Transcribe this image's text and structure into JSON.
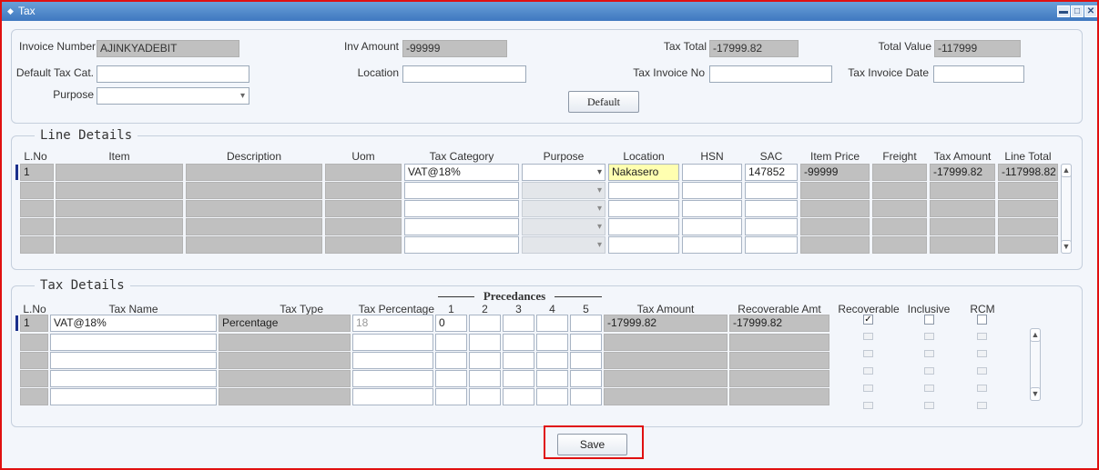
{
  "window": {
    "title": "Tax"
  },
  "header": {
    "invoice_number_label": "Invoice Number",
    "invoice_number": "AJINKYADEBIT",
    "inv_amount_label": "Inv Amount",
    "inv_amount": "-99999",
    "tax_total_label": "Tax Total",
    "tax_total": "-17999.82",
    "total_value_label": "Total Value",
    "total_value": "-117999",
    "default_tax_cat_label": "Default Tax Cat.",
    "location_label": "Location",
    "tax_invoice_no_label": "Tax Invoice No",
    "tax_invoice_date_label": "Tax Invoice Date",
    "purpose_label": "Purpose",
    "default_button": "Default"
  },
  "line_details": {
    "title": "Line Details",
    "columns": [
      "L.No",
      "Item",
      "Description",
      "Uom",
      "Tax Category",
      "Purpose",
      "Location",
      "HSN",
      "SAC",
      "Item Price",
      "Freight",
      "Tax Amount",
      "Line Total"
    ],
    "row1": {
      "lno": "1",
      "tax_category": "VAT@18%",
      "location": "Nakasero",
      "sac": "147852",
      "item_price": "-99999",
      "tax_amount": "-17999.82",
      "line_total": "-117998.82"
    }
  },
  "tax_details": {
    "title": "Tax Details",
    "precedances_label": "Precedances",
    "columns": {
      "lno": "L.No",
      "tax_name": "Tax Name",
      "tax_type": "Tax Type",
      "tax_percentage": "Tax Percentage",
      "p1": "1",
      "p2": "2",
      "p3": "3",
      "p4": "4",
      "p5": "5",
      "tax_amount": "Tax Amount",
      "recoverable_amt": "Recoverable Amt",
      "recoverable": "Recoverable",
      "inclusive": "Inclusive",
      "rcm": "RCM"
    },
    "row1": {
      "lno": "1",
      "tax_name": "VAT@18%",
      "tax_type": "Percentage",
      "tax_percentage": "18",
      "p1": "0",
      "tax_amount": "-17999.82",
      "recoverable_amt": "-17999.82",
      "recoverable_checked": true
    }
  },
  "footer": {
    "save_button": "Save"
  },
  "colors": {
    "highlight_border": "#e01010",
    "titlebar": "#4a86c8",
    "readonly_field": "#c0c0c0",
    "current_row_marker": "#1a2f8c",
    "location_highlight": "#ffffb0"
  }
}
